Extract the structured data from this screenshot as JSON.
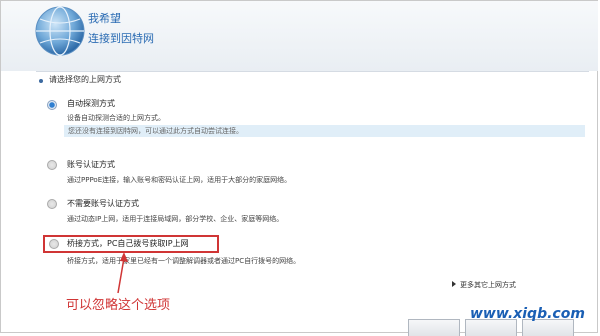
{
  "header": {
    "title": "我希望",
    "subtitle": "连接到因特网"
  },
  "prompt": "请选择您的上网方式",
  "options": [
    {
      "title": "自动探测方式",
      "desc": "设备自动探测合适的上网方式。",
      "hint": "您还没有连接到因特网，可以通过此方式自动尝试连接。",
      "selected": true
    },
    {
      "title": "账号认证方式",
      "desc": "通过PPPoE连接，输入账号和密码认证上网，适用于大部分的家庭网络。",
      "selected": false
    },
    {
      "title": "不需要账号认证方式",
      "desc": "通过动态IP上网，适用于连接局域网，部分学校、企业、家庭等网络。",
      "selected": false
    },
    {
      "title": "桥接方式，PC自己拨号获取IP上网",
      "desc": "桥接方式，适用于家里已经有一个调整解调器或者通过PC自行拨号的网络。",
      "selected": false
    }
  ],
  "more_link": "更多其它上网方式",
  "annotation": "可以忽略这个选项",
  "watermark": "www.xiqb.com",
  "colors": {
    "accent": "#2a6bb3",
    "highlight": "#d03535",
    "hint_bg": "#e0eef8"
  }
}
